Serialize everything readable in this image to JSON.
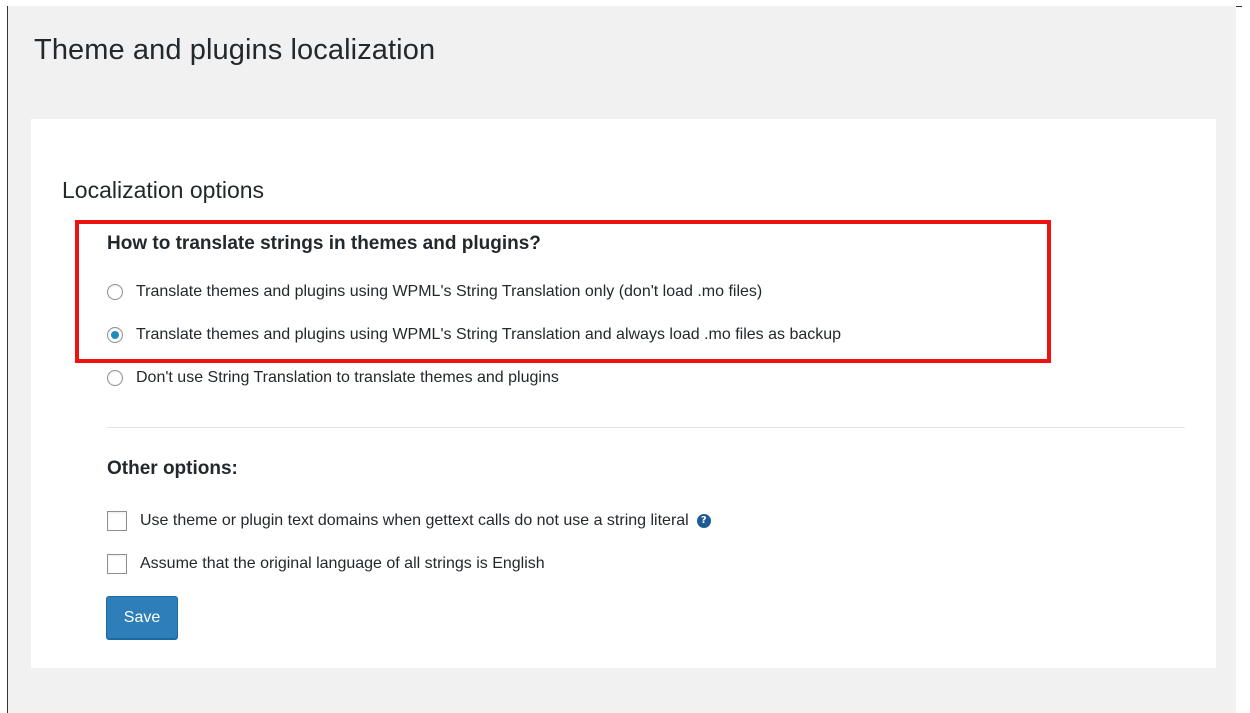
{
  "page": {
    "title": "Theme and plugins localization"
  },
  "localization": {
    "section_title": "Localization options",
    "question": "How to translate strings in themes and plugins?",
    "options": [
      {
        "label": "Translate themes and plugins using WPML's String Translation only (don't load .mo files)",
        "checked": false
      },
      {
        "label": "Translate themes and plugins using WPML's String Translation and always load .mo files as backup",
        "checked": true
      },
      {
        "label": "Don't use String Translation to translate themes and plugins",
        "checked": false
      }
    ],
    "highlight_color": "#ee1111"
  },
  "other": {
    "title": "Other options:",
    "checkboxes": [
      {
        "label": "Use theme or plugin text domains when gettext calls do not use a string literal",
        "checked": false,
        "help_icon": "question-circle-icon"
      },
      {
        "label": "Assume that the original language of all strings is English",
        "checked": false
      }
    ]
  },
  "actions": {
    "save_label": "Save",
    "accent_color": "#2e7fb9"
  }
}
